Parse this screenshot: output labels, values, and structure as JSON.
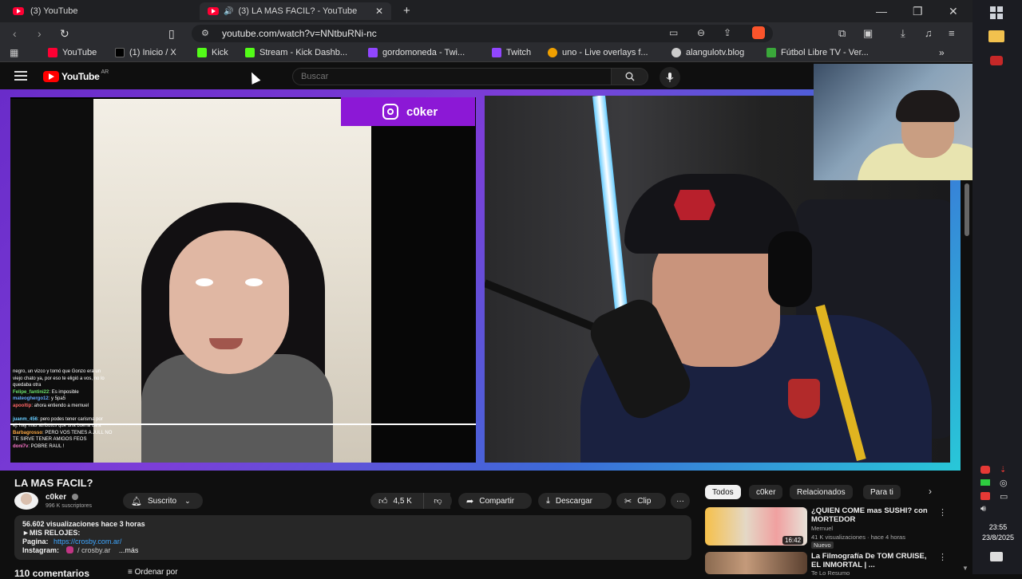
{
  "browser": {
    "tabs": [
      {
        "label": "(3) YouTube",
        "active": false
      },
      {
        "label": "(3) LA MAS FACIL? - YouTube",
        "active": true
      }
    ],
    "new_tab": "+",
    "url": "youtube.com/watch?v=NNtbuRNi-nc",
    "bookmarks": [
      {
        "label": "YouTube",
        "icon_color": "#ff0033"
      },
      {
        "label": "(1) Inicio / X",
        "icon_color": "#000000"
      },
      {
        "label": "Kick",
        "icon_color": "#53fc18"
      },
      {
        "label": "Stream - Kick Dashb...",
        "icon_color": "#53fc18"
      },
      {
        "label": "gordomoneda - Twi...",
        "icon_color": "#9146ff"
      },
      {
        "label": "Twitch",
        "icon_color": "#9146ff"
      },
      {
        "label": "uno - Live overlays f...",
        "icon_color": "#f0a000"
      },
      {
        "label": "alangulotv.blog",
        "icon_color": "#cccccc"
      },
      {
        "label": "Fútbol Libre TV - Ver...",
        "icon_color": "#3aa83a"
      }
    ],
    "bookmarks_more": "»"
  },
  "youtube": {
    "logo_text": "YouTube",
    "region": "AR",
    "search_placeholder": "Buscar"
  },
  "overlay": {
    "ig_handle": "c0ker",
    "chat": [
      {
        "user": "",
        "text": "negro, un vizco y tomó que Gonzo era un"
      },
      {
        "user": "",
        "text": "viejo chato ya, por eso te eligió a vos, no lo"
      },
      {
        "user": "",
        "text": "quedaba otra"
      },
      {
        "user": "Felipe_fantini22",
        "text": ": Es imposible"
      },
      {
        "user": "mateoghergo12",
        "text": ": y 5pa5"
      },
      {
        "user": "apooltip",
        "text": ": ahora entiendo a mernuel"
      },
      {
        "user": "juanm_456",
        "text": ": pero podes tener carisma por"
      },
      {
        "user": "",
        "text": "ej. hay mas atributos que una buena cara"
      },
      {
        "user": "Barbagrosso",
        "text": ": PERO VOS TENES A JULL NO"
      },
      {
        "user": "",
        "text": "TE SIRVE TENER AMIGOS FEOS"
      },
      {
        "user": "doni7v",
        "text": ": POBRE RAUL !"
      }
    ]
  },
  "video": {
    "title": "LA MAS FACIL?",
    "channel": "c0ker",
    "subscribers": "996 K suscriptores",
    "subscribe_label": "Suscrito",
    "likes": "4,5 K",
    "share_label": "Compartir",
    "download_label": "Descargar",
    "clip_label": "Clip",
    "more_label": "···",
    "description": {
      "stats": "56.602 visualizaciones  hace 3 horas",
      "line1": "►MIS RELOJES:",
      "line2_label": "Pagina:",
      "line2_link": "https://crosby.com.ar/",
      "line3_label": "Instagram:",
      "line3_value": "/ crosby.ar",
      "more": "...más"
    },
    "comments_count": "110 comentarios",
    "order_by": "Ordenar por"
  },
  "related": {
    "chips": [
      "Todos",
      "c0ker",
      "Relacionados",
      "Para ti"
    ],
    "items": [
      {
        "title": "¿QUIEN COME mas SUSHI? con MORTEDOR",
        "channel": "Mernuel",
        "meta": "41 K visualizaciones · hace 4 horas",
        "badge": "Nuevo",
        "duration": "16:42"
      },
      {
        "title": "La Filmografía De TOM CRUISE, EL INMORTAL | ...",
        "channel": "Te Lo Resumo",
        "meta": "",
        "badge": "",
        "duration": ""
      }
    ]
  },
  "taskbar": {
    "time": "23:55",
    "date": "23/8/2025"
  }
}
